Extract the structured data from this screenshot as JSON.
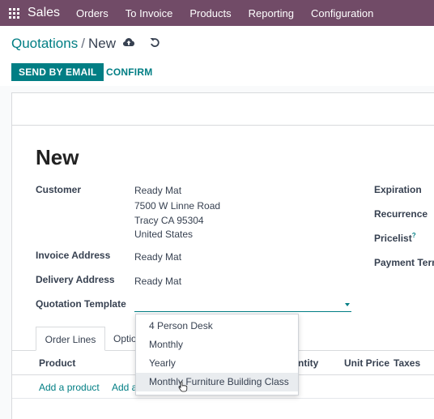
{
  "navbar": {
    "app_name": "Sales",
    "menu": [
      "Orders",
      "To Invoice",
      "Products",
      "Reporting",
      "Configuration"
    ]
  },
  "breadcrumb": {
    "parent": "Quotations",
    "separator": "/",
    "current": "New"
  },
  "actions": {
    "send_email": "SEND BY EMAIL",
    "confirm": "CONFIRM"
  },
  "form": {
    "title": "New",
    "customer_label": "Customer",
    "customer_name": "Ready Mat",
    "address_line1": "7500 W Linne Road",
    "address_line2": "Tracy CA 95304",
    "address_line3": "United States",
    "invoice_address_label": "Invoice Address",
    "invoice_address_value": "Ready Mat",
    "delivery_address_label": "Delivery Address",
    "delivery_address_value": "Ready Mat",
    "template_label": "Quotation Template",
    "template_value": "",
    "expiration_label": "Expiration",
    "recurrence_label": "Recurrence",
    "pricelist_label": "Pricelist",
    "pricelist_help": "?",
    "payment_terms_label": "Payment Term"
  },
  "tabs": {
    "order_lines": "Order Lines",
    "optional_partial": "Optio"
  },
  "table": {
    "col_product": "Product",
    "col_quantity_partial": "ntity",
    "col_unit_price": "Unit Price",
    "col_taxes": "Taxes",
    "add_product": "Add a product",
    "add_section_partial": "Add a"
  },
  "dropdown": {
    "options": [
      "4 Person Desk",
      "Monthly",
      "Yearly",
      "Monthly Furniture Building Class"
    ],
    "hover_index": 3
  },
  "colors": {
    "brand": "#714b67",
    "accent": "#017e84"
  }
}
